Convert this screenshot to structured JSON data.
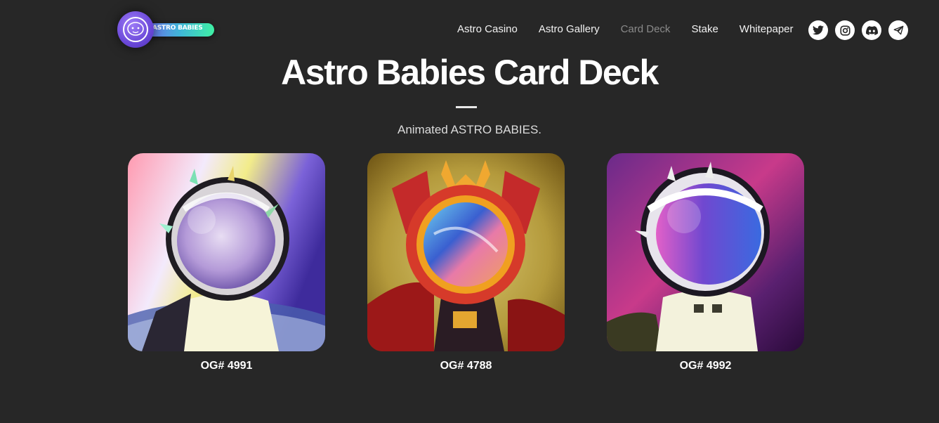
{
  "brand": {
    "name": "ASTRO BABIES"
  },
  "nav": {
    "items": [
      {
        "label": "Astro Casino"
      },
      {
        "label": "Astro Gallery"
      },
      {
        "label": "Card Deck",
        "active": true
      },
      {
        "label": "Stake"
      },
      {
        "label": "Whitepaper"
      }
    ]
  },
  "socials": [
    {
      "icon": "twitter-icon"
    },
    {
      "icon": "instagram-icon"
    },
    {
      "icon": "discord-icon"
    },
    {
      "icon": "telegram-icon"
    }
  ],
  "hero": {
    "title": "Astro Babies Card Deck",
    "subtitle": "Animated ASTRO BABIES."
  },
  "cards": [
    {
      "label": "OG# 4991"
    },
    {
      "label": "OG# 4788"
    },
    {
      "label": "OG# 4992"
    }
  ],
  "colors": {
    "background": "#272727",
    "accent_purple": "#7a5cf0",
    "accent_green": "#3ff0a4",
    "nav_active": "#8a8a8a"
  }
}
